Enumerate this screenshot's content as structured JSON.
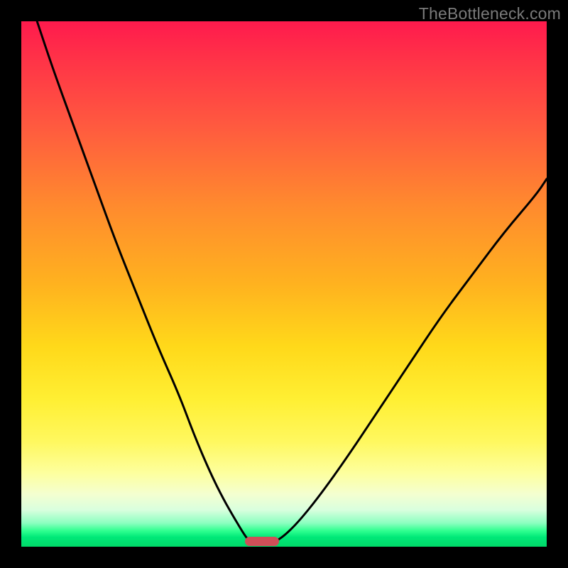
{
  "watermark": {
    "text": "TheBottleneck.com"
  },
  "colors": {
    "frame": "#000000",
    "curve": "#000000",
    "marker": "#cf4f58",
    "gradient_stops": [
      "#ff1a4d",
      "#ff3547",
      "#ff5a3f",
      "#ff8a2e",
      "#ffb21f",
      "#ffd91a",
      "#ffef33",
      "#fff85f",
      "#fdff9e",
      "#f4ffd0",
      "#d9ffde",
      "#8cffc0",
      "#2eff8f",
      "#00e878",
      "#00d968"
    ]
  },
  "chart_data": {
    "type": "line",
    "title": "",
    "xlabel": "",
    "ylabel": "",
    "xlim": [
      0,
      100
    ],
    "ylim": [
      0,
      100
    ],
    "grid": false,
    "series": [
      {
        "name": "left-branch",
        "x": [
          3,
          6,
          10,
          14,
          18,
          22,
          26,
          30,
          33,
          36,
          38.5,
          40.5,
          42,
          43,
          43.8
        ],
        "y": [
          100,
          91,
          80,
          69,
          58,
          48,
          38,
          29,
          21,
          14,
          9,
          5.5,
          3,
          1.5,
          0.8
        ]
      },
      {
        "name": "right-branch",
        "x": [
          48,
          50,
          53,
          57,
          62,
          68,
          74,
          80,
          86,
          92,
          98,
          100
        ],
        "y": [
          0.8,
          2,
          5,
          10,
          17,
          26,
          35,
          44,
          52,
          60,
          67,
          70
        ]
      }
    ],
    "marker": {
      "name": "bottleneck-marker",
      "x_center": 45.8,
      "width_pct": 6.5,
      "y": 0.2
    },
    "background_meaning": "vertical gradient red (high bottleneck) → green (low bottleneck)"
  }
}
